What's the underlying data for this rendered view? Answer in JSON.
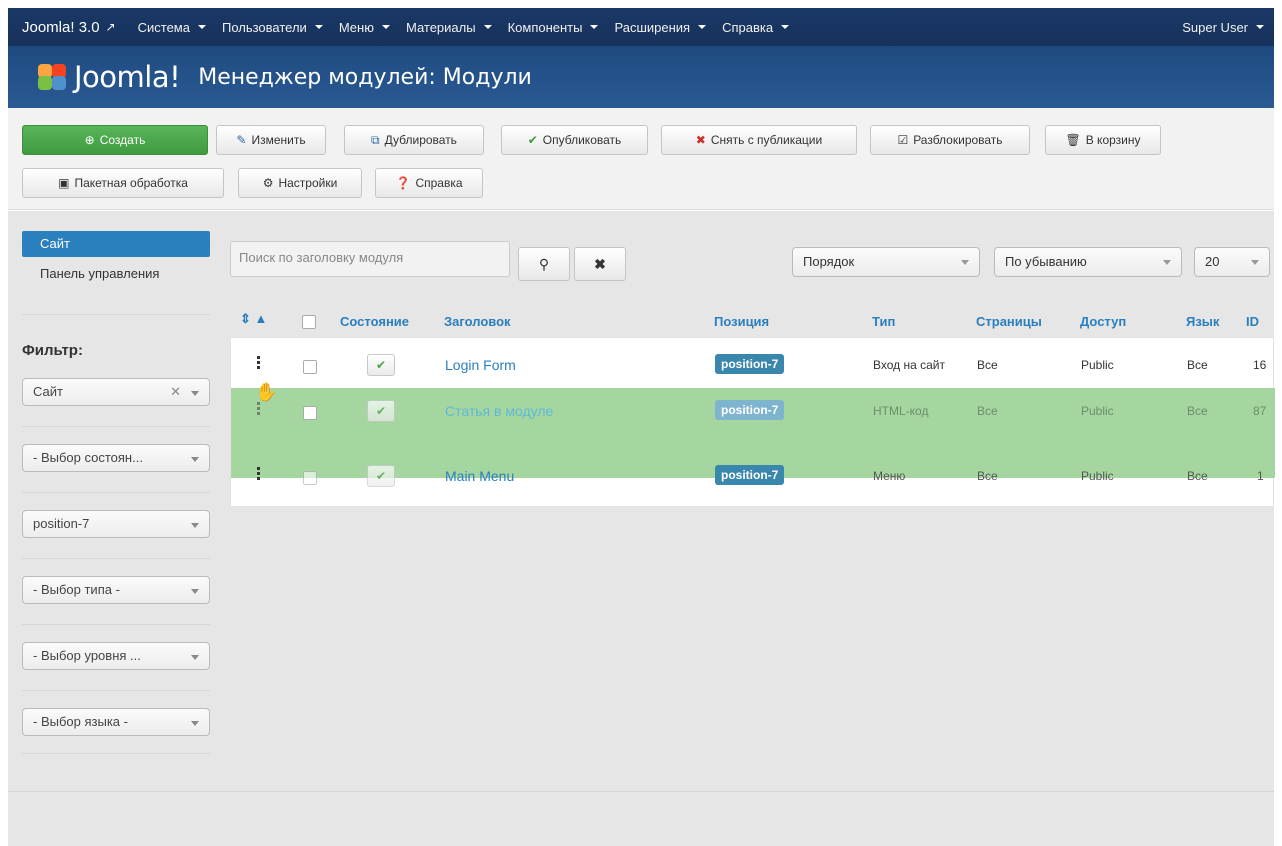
{
  "navbar": {
    "brand": "Joomla! 3.0",
    "menu": [
      "Система",
      "Пользователи",
      "Меню",
      "Материалы",
      "Компоненты",
      "Расширения",
      "Справка"
    ],
    "user": "Super User"
  },
  "header": {
    "logo_text": "Joomla!",
    "title": "Менеджер модулей: Модули"
  },
  "toolbar": {
    "create": "Создать",
    "edit": "Изменить",
    "duplicate": "Дублировать",
    "publish": "Опубликовать",
    "unpublish": "Снять с публикации",
    "checkin": "Разблокировать",
    "trash": "В корзину",
    "batch": "Пакетная обработка",
    "options": "Настройки",
    "help": "Справка"
  },
  "sidebar": {
    "items": [
      "Сайт",
      "Панель управления"
    ],
    "filter_label": "Фильтр:",
    "filters": [
      "Сайт",
      "- Выбор состоян...",
      "position-7",
      "- Выбор типа -",
      "- Выбор уровня ...",
      "- Выбор языка -"
    ]
  },
  "search": {
    "placeholder": "Поиск по заголовку модуля"
  },
  "sort": {
    "order": "Порядок",
    "direction": "По убыванию",
    "limit": "20"
  },
  "table": {
    "headers": {
      "state": "Состояние",
      "title": "Заголовок",
      "position": "Позиция",
      "type": "Тип",
      "pages": "Страницы",
      "access": "Доступ",
      "language": "Язык",
      "id": "ID"
    },
    "rows": [
      {
        "title": "Login Form",
        "position": "position-7",
        "type": "Вход на сайт",
        "pages": "Все",
        "access": "Public",
        "language": "Все",
        "id": "16"
      },
      {
        "title": "Статья в модуле",
        "position": "position-7",
        "type": "HTML-код",
        "pages": "Все",
        "access": "Public",
        "language": "Все",
        "id": "87"
      },
      {
        "title": "Main Menu",
        "position": "position-7",
        "type": "Меню",
        "pages": "Все",
        "access": "Public",
        "language": "Все",
        "id": "1"
      }
    ]
  },
  "colors": {
    "navbar": "#17325b",
    "header": "#2a5a93",
    "accent": "#2a7fbf",
    "success": "#47a447",
    "drag_highlight": "#a5d6a0",
    "badge": "#3a87ad"
  }
}
